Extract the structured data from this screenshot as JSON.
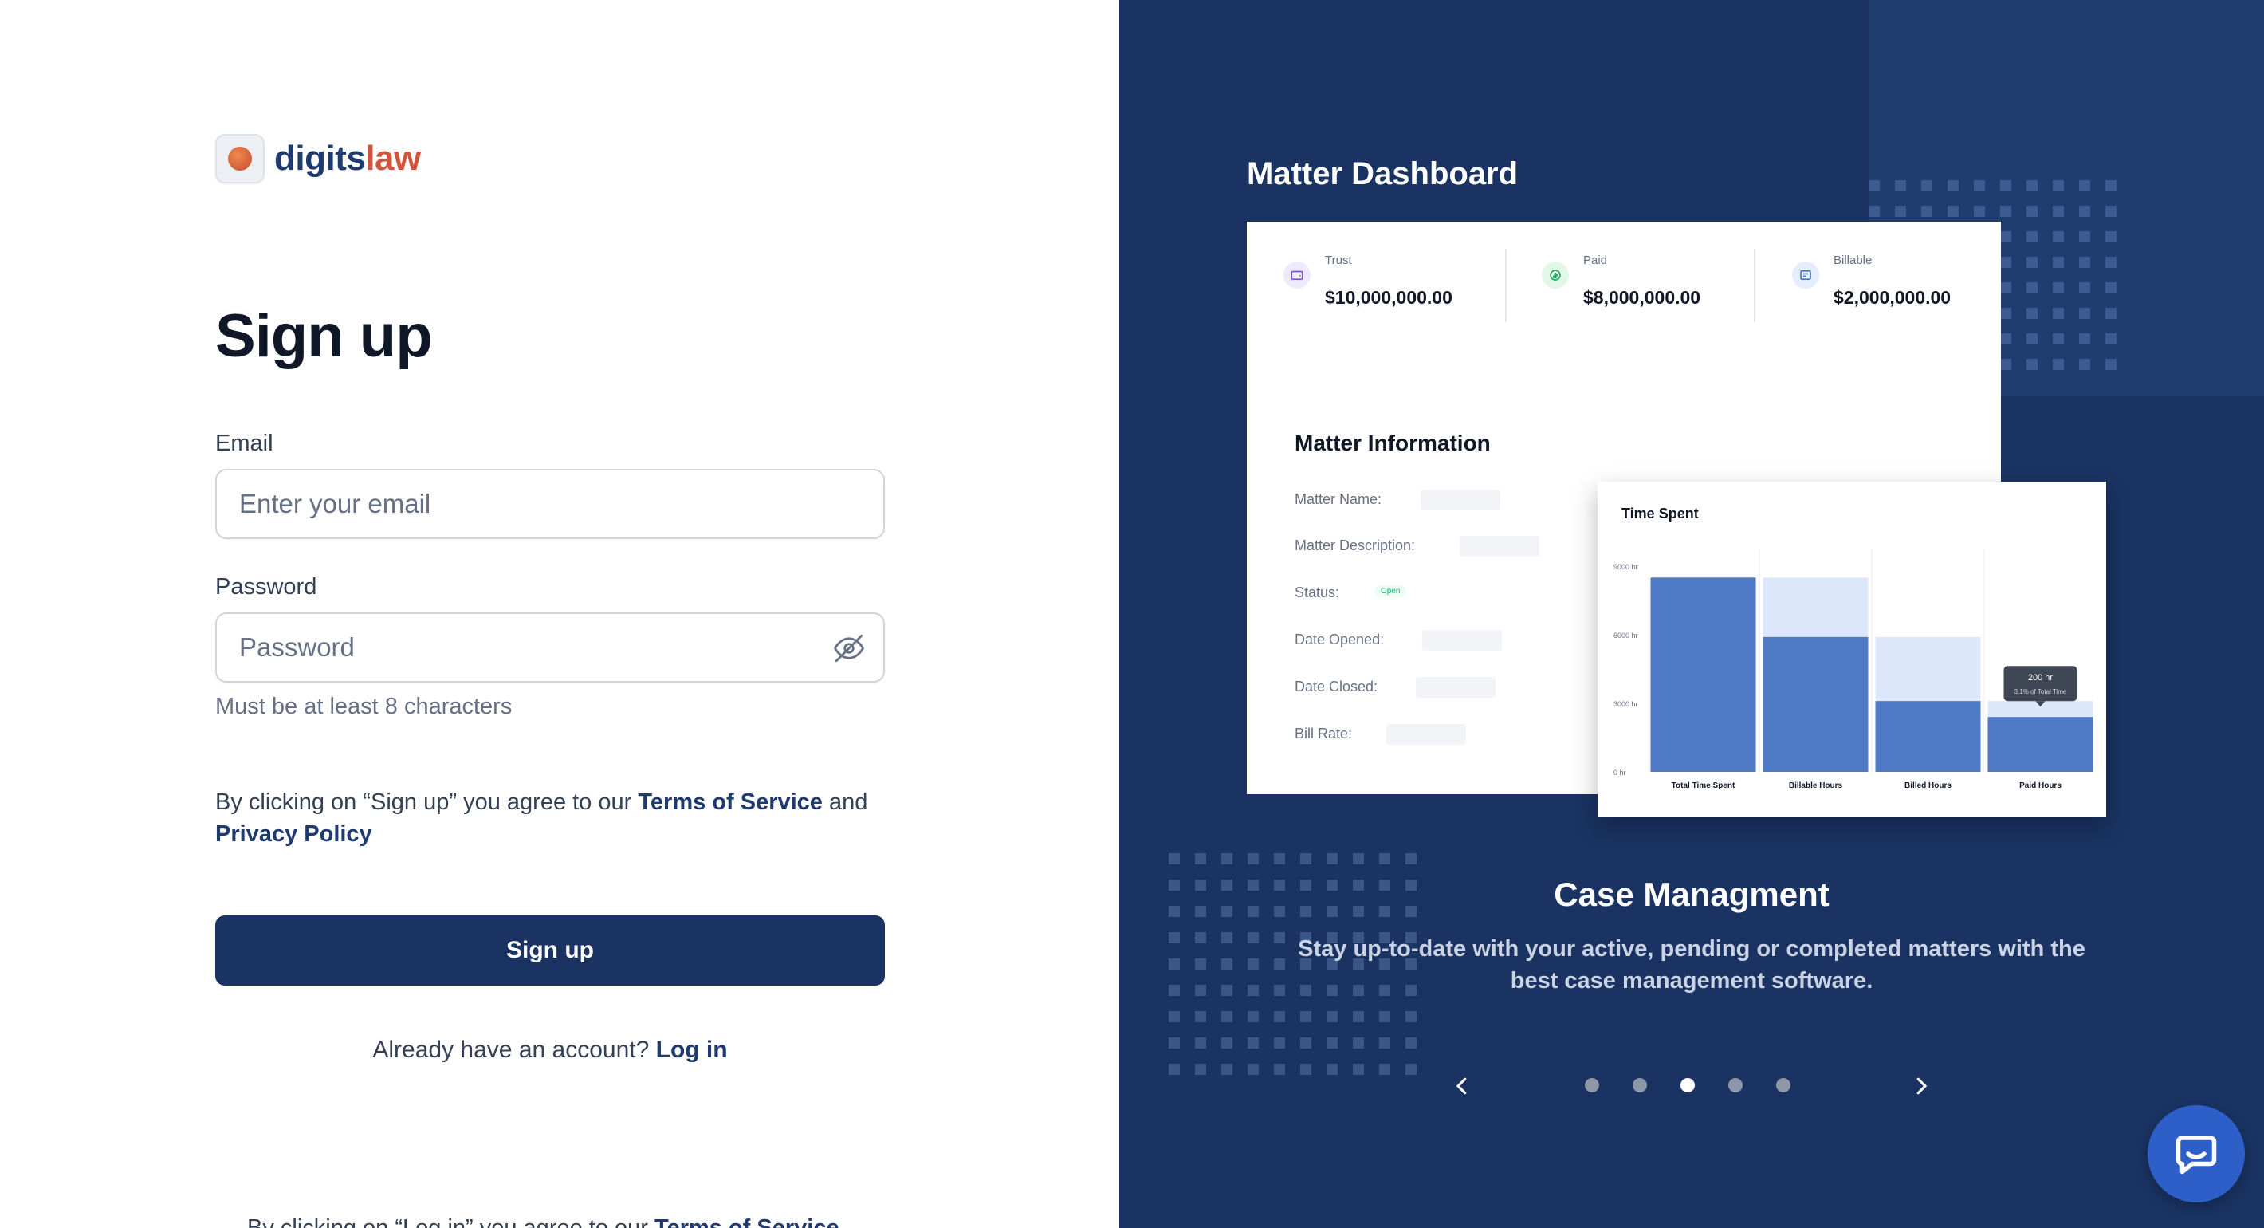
{
  "brand": {
    "name_part1": "digits",
    "name_part2": "law"
  },
  "form": {
    "title": "Sign up",
    "email_label": "Email",
    "email_placeholder": "Enter your email",
    "email_value": "",
    "password_label": "Password",
    "password_placeholder": "Password",
    "password_value": "",
    "password_hint": "Must be at least 8 characters",
    "terms_prefix": "By clicking on “Sign up” you agree to our",
    "terms_link": "Terms of Service",
    "terms_and": "and",
    "privacy_link": "Privacy Policy",
    "submit_label": "Sign up",
    "login_prompt": "Already have an account?",
    "login_link": "Log in",
    "cut_prefix": "By clicking on “Log in” you agree to our",
    "cut_link": "Terms of Service"
  },
  "showcase": {
    "dashboard_title": "Matter Dashboard",
    "stats": [
      {
        "name": "Trust",
        "value": "$10,000,000.00",
        "icon": "wallet-icon"
      },
      {
        "name": "Paid",
        "value": "$8,000,000.00",
        "icon": "paid-icon"
      },
      {
        "name": "Billable",
        "value": "$2,000,000.00",
        "icon": "billable-icon"
      }
    ],
    "matter_info": {
      "title": "Matter Information",
      "labels": [
        "Matter Name:",
        "Matter Description:",
        "Status:",
        "Date Opened:",
        "Date Closed:",
        "Bill Rate:"
      ],
      "status_badge": "Open"
    },
    "chart_data": {
      "type": "bar",
      "title": "Time Spent",
      "categories": [
        "Total Time Spent",
        "Billable Hours",
        "Billed Hours",
        "Paid Hours"
      ],
      "y_ticks": [
        "9000 hr",
        "6000 hr",
        "3000 hr",
        "0 hr"
      ],
      "ylim": [
        0,
        9000
      ],
      "series": [
        {
          "values": [
            8500,
            5900,
            3100,
            2400
          ]
        },
        {
          "values": [
            8500,
            8500,
            5900,
            3100
          ]
        }
      ],
      "tooltip": {
        "value": "200 hr",
        "detail": "3.1% of Total Time",
        "category": "Paid Hours"
      },
      "colors": {
        "primary": "#4f7ac6",
        "background": "#dce7fb"
      }
    },
    "slide_title": "Case Managment",
    "slide_text": "Stay up-to-date with your active, pending or completed matters with the best case management software.",
    "slides_count": 5,
    "active_slide": 3
  },
  "colors": {
    "primary": "#1a3363",
    "accent": "#d1553a",
    "panel": "#1a3363",
    "chat": "#2e5ec8"
  }
}
